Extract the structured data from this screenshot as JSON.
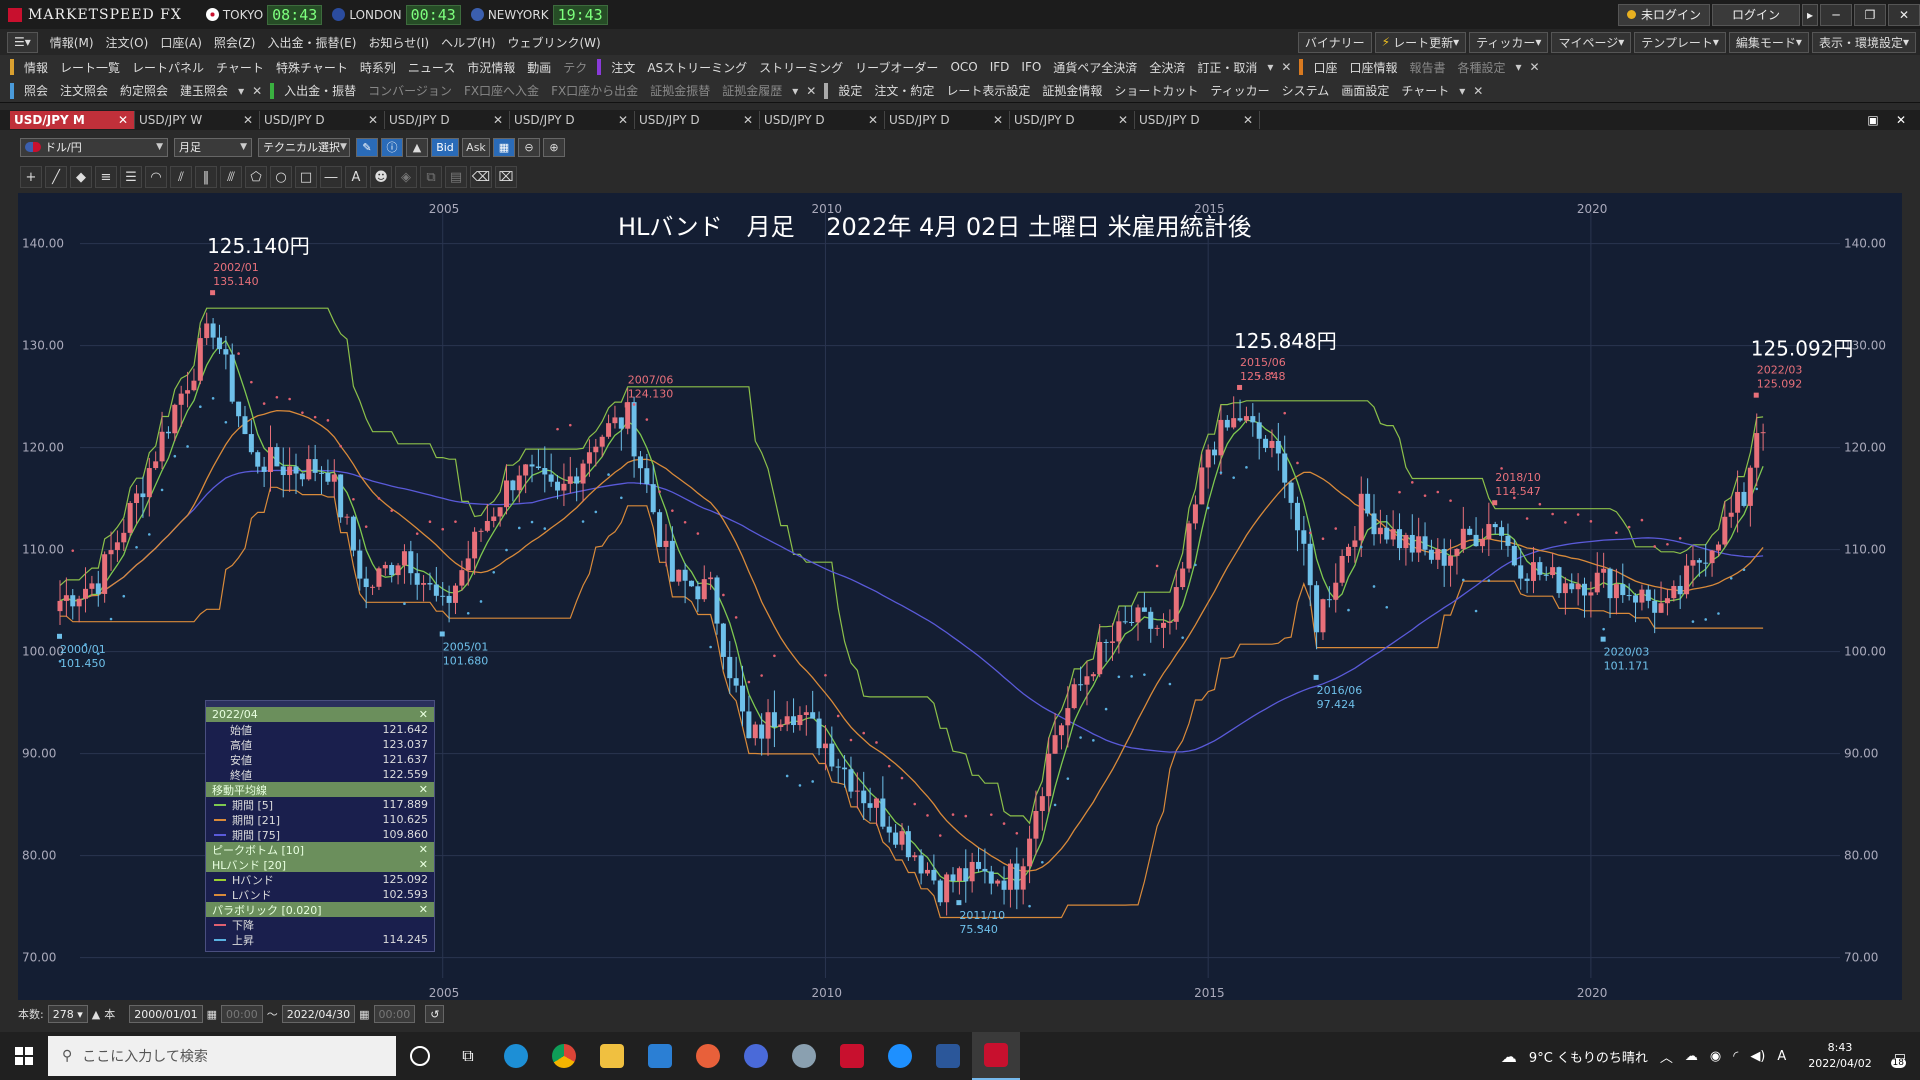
{
  "app": {
    "title": "MARKETSPEED FX",
    "clocks": [
      {
        "city": "TOKYO",
        "time": "08:43",
        "flag_color": "#c8102e"
      },
      {
        "city": "LONDON",
        "time": "00:43",
        "flag_color": "#2b4c9e"
      },
      {
        "city": "NEWYORK",
        "time": "19:43",
        "flag_color": "#3b5fae"
      }
    ],
    "login_status": "未ログイン",
    "login_button": "ログイン"
  },
  "menu": {
    "items": [
      "情報(M)",
      "注文(O)",
      "口座(A)",
      "照会(Z)",
      "入出金・振替(E)",
      "お知らせ(I)",
      "ヘルプ(H)",
      "ウェブリンク(W)"
    ],
    "right_buttons": [
      "バイナリー",
      "レート更新",
      "ティッカー",
      "マイページ",
      "テンプレート",
      "編集モード",
      "表示・環境設定"
    ]
  },
  "toolbar1": {
    "info_label": "情報",
    "info_items": [
      "レート一覧",
      "レートパネル",
      "チャート",
      "特殊チャート",
      "時系列",
      "ニュース",
      "市況情報",
      "動画",
      "テク"
    ],
    "order_label": "注文",
    "order_items": [
      "ASストリーミング",
      "ストリーミング",
      "リーブオーダー",
      "OCO",
      "IFD",
      "IFO",
      "通貨ペア全決済",
      "全決済",
      "訂正・取消"
    ],
    "account_label": "口座",
    "account_items": [
      "口座情報",
      "報告書",
      "各種設定"
    ]
  },
  "toolbar2": {
    "inquiry_label": "照会",
    "inquiry_items": [
      "注文照会",
      "約定照会",
      "建玉照会"
    ],
    "transfer_label": "入出金・振替",
    "transfer_items": [
      "コンバージョン",
      "FX口座へ入金",
      "FX口座から出金",
      "証拠金振替",
      "証拠金履歴"
    ],
    "settings_label": "設定",
    "settings_items": [
      "注文・約定",
      "レート表示設定",
      "証拠金情報",
      "ショートカット",
      "ティッカー",
      "システム",
      "画面設定",
      "チャート"
    ]
  },
  "tabs": [
    "USD/JPY M",
    "USD/JPY W",
    "USD/JPY D",
    "USD/JPY D",
    "USD/JPY D",
    "USD/JPY D",
    "USD/JPY D",
    "USD/JPY D",
    "USD/JPY D",
    "USD/JPY D"
  ],
  "chart_toolbar": {
    "pair": "ドル/円",
    "period": "月足",
    "technical": "テクニカル選択",
    "bid": "Bid",
    "ask": "Ask"
  },
  "chart_data": {
    "type": "candlestick",
    "title": "HLバンド　月足　 2022年 4月 02日 土曜日 米雇用統計後",
    "ylim": [
      68,
      143
    ],
    "y_ticks": [
      "140.00",
      "130.00",
      "120.00",
      "110.00",
      "100.00",
      "90.00",
      "80.00",
      "70.00"
    ],
    "x_ticks": [
      "2005",
      "2010",
      "2015",
      "2020"
    ],
    "x_range": [
      "2000/01",
      "2022/04"
    ],
    "annotations": [
      {
        "big": "125.140円",
        "date": "2002/01",
        "value": "135.140",
        "kind": "peak"
      },
      {
        "date": "2007/06",
        "value": "124.130",
        "kind": "peak"
      },
      {
        "big": "125.848円",
        "date": "2015/06",
        "value": "125.848",
        "kind": "peak"
      },
      {
        "date": "2018/10",
        "value": "114.547",
        "kind": "peak"
      },
      {
        "big": "125.092円",
        "date": "2022/03",
        "value": "125.092",
        "kind": "peak"
      },
      {
        "date": "2000/01",
        "value": "101.450",
        "kind": "bottom"
      },
      {
        "date": "2005/01",
        "value": "101.680",
        "kind": "bottom"
      },
      {
        "date": "2011/10",
        "value": "75.340",
        "kind": "bottom"
      },
      {
        "date": "2016/06",
        "value": "97.424",
        "kind": "bottom"
      },
      {
        "date": "2020/03",
        "value": "101.171",
        "kind": "bottom"
      }
    ],
    "close_series": {
      "x": [
        "2000/01",
        "2000/07",
        "2001/01",
        "2001/07",
        "2002/01",
        "2002/07",
        "2003/01",
        "2003/07",
        "2004/01",
        "2004/07",
        "2005/01",
        "2005/07",
        "2006/01",
        "2006/07",
        "2007/01",
        "2007/06",
        "2008/01",
        "2008/07",
        "2009/01",
        "2009/07",
        "2010/01",
        "2010/07",
        "2011/01",
        "2011/07",
        "2011/10",
        "2012/07",
        "2013/01",
        "2013/07",
        "2014/01",
        "2014/07",
        "2015/01",
        "2015/06",
        "2016/01",
        "2016/06",
        "2017/01",
        "2017/07",
        "2018/01",
        "2018/10",
        "2019/01",
        "2019/07",
        "2020/03",
        "2020/07",
        "2021/01",
        "2021/07",
        "2022/01",
        "2022/03",
        "2022/04"
      ],
      "y": [
        105,
        107,
        115,
        124,
        132,
        119,
        118,
        118,
        106,
        110,
        104,
        112,
        118,
        115,
        121,
        123,
        107,
        106,
        91,
        95,
        91,
        86,
        82,
        77,
        78,
        78,
        92,
        99,
        103,
        102,
        120,
        123,
        118,
        103,
        114,
        111,
        109,
        113,
        109,
        107,
        107,
        106,
        104,
        110,
        115,
        122,
        122.6
      ]
    },
    "legend": {
      "period": "2022/04",
      "ohlc": [
        {
          "label": "始値",
          "value": "121.642"
        },
        {
          "label": "高値",
          "value": "123.037"
        },
        {
          "label": "安値",
          "value": "121.637"
        },
        {
          "label": "終値",
          "value": "122.559"
        }
      ],
      "ma_title": "移動平均線",
      "ma": [
        {
          "label": "期間 [5]",
          "value": "117.889",
          "color": "#7ec850"
        },
        {
          "label": "期間 [21]",
          "value": "110.625",
          "color": "#d98a3a"
        },
        {
          "label": "期間 [75]",
          "value": "109.860",
          "color": "#5a5ad9"
        }
      ],
      "peak_bottom_title": "ピークボトム [10]",
      "hl_title": "HLバンド [20]",
      "hl": [
        {
          "label": "Hバンド",
          "value": "125.092",
          "color": "#9acd32"
        },
        {
          "label": "Lバンド",
          "value": "102.593",
          "color": "#d98a3a"
        }
      ],
      "parabolic_title": "パラボリック [0.020]",
      "parabolic": [
        {
          "label": "下降",
          "value": "",
          "color": "#e06070"
        },
        {
          "label": "上昇",
          "value": "114.245",
          "color": "#5ab0e0"
        }
      ]
    }
  },
  "bottom": {
    "count_label": "本数:",
    "count": "278",
    "unit": "本",
    "from_date": "2000/01/01",
    "from_time": "00:00",
    "tilde": "〜",
    "to_date": "2022/04/30",
    "to_time": "00:00"
  },
  "taskbar": {
    "search_placeholder": "ここに入力して検索",
    "weather": "9°C くもりのち晴れ",
    "ime": "A",
    "time": "8:43",
    "date": "2022/04/02",
    "notifications": "18"
  }
}
